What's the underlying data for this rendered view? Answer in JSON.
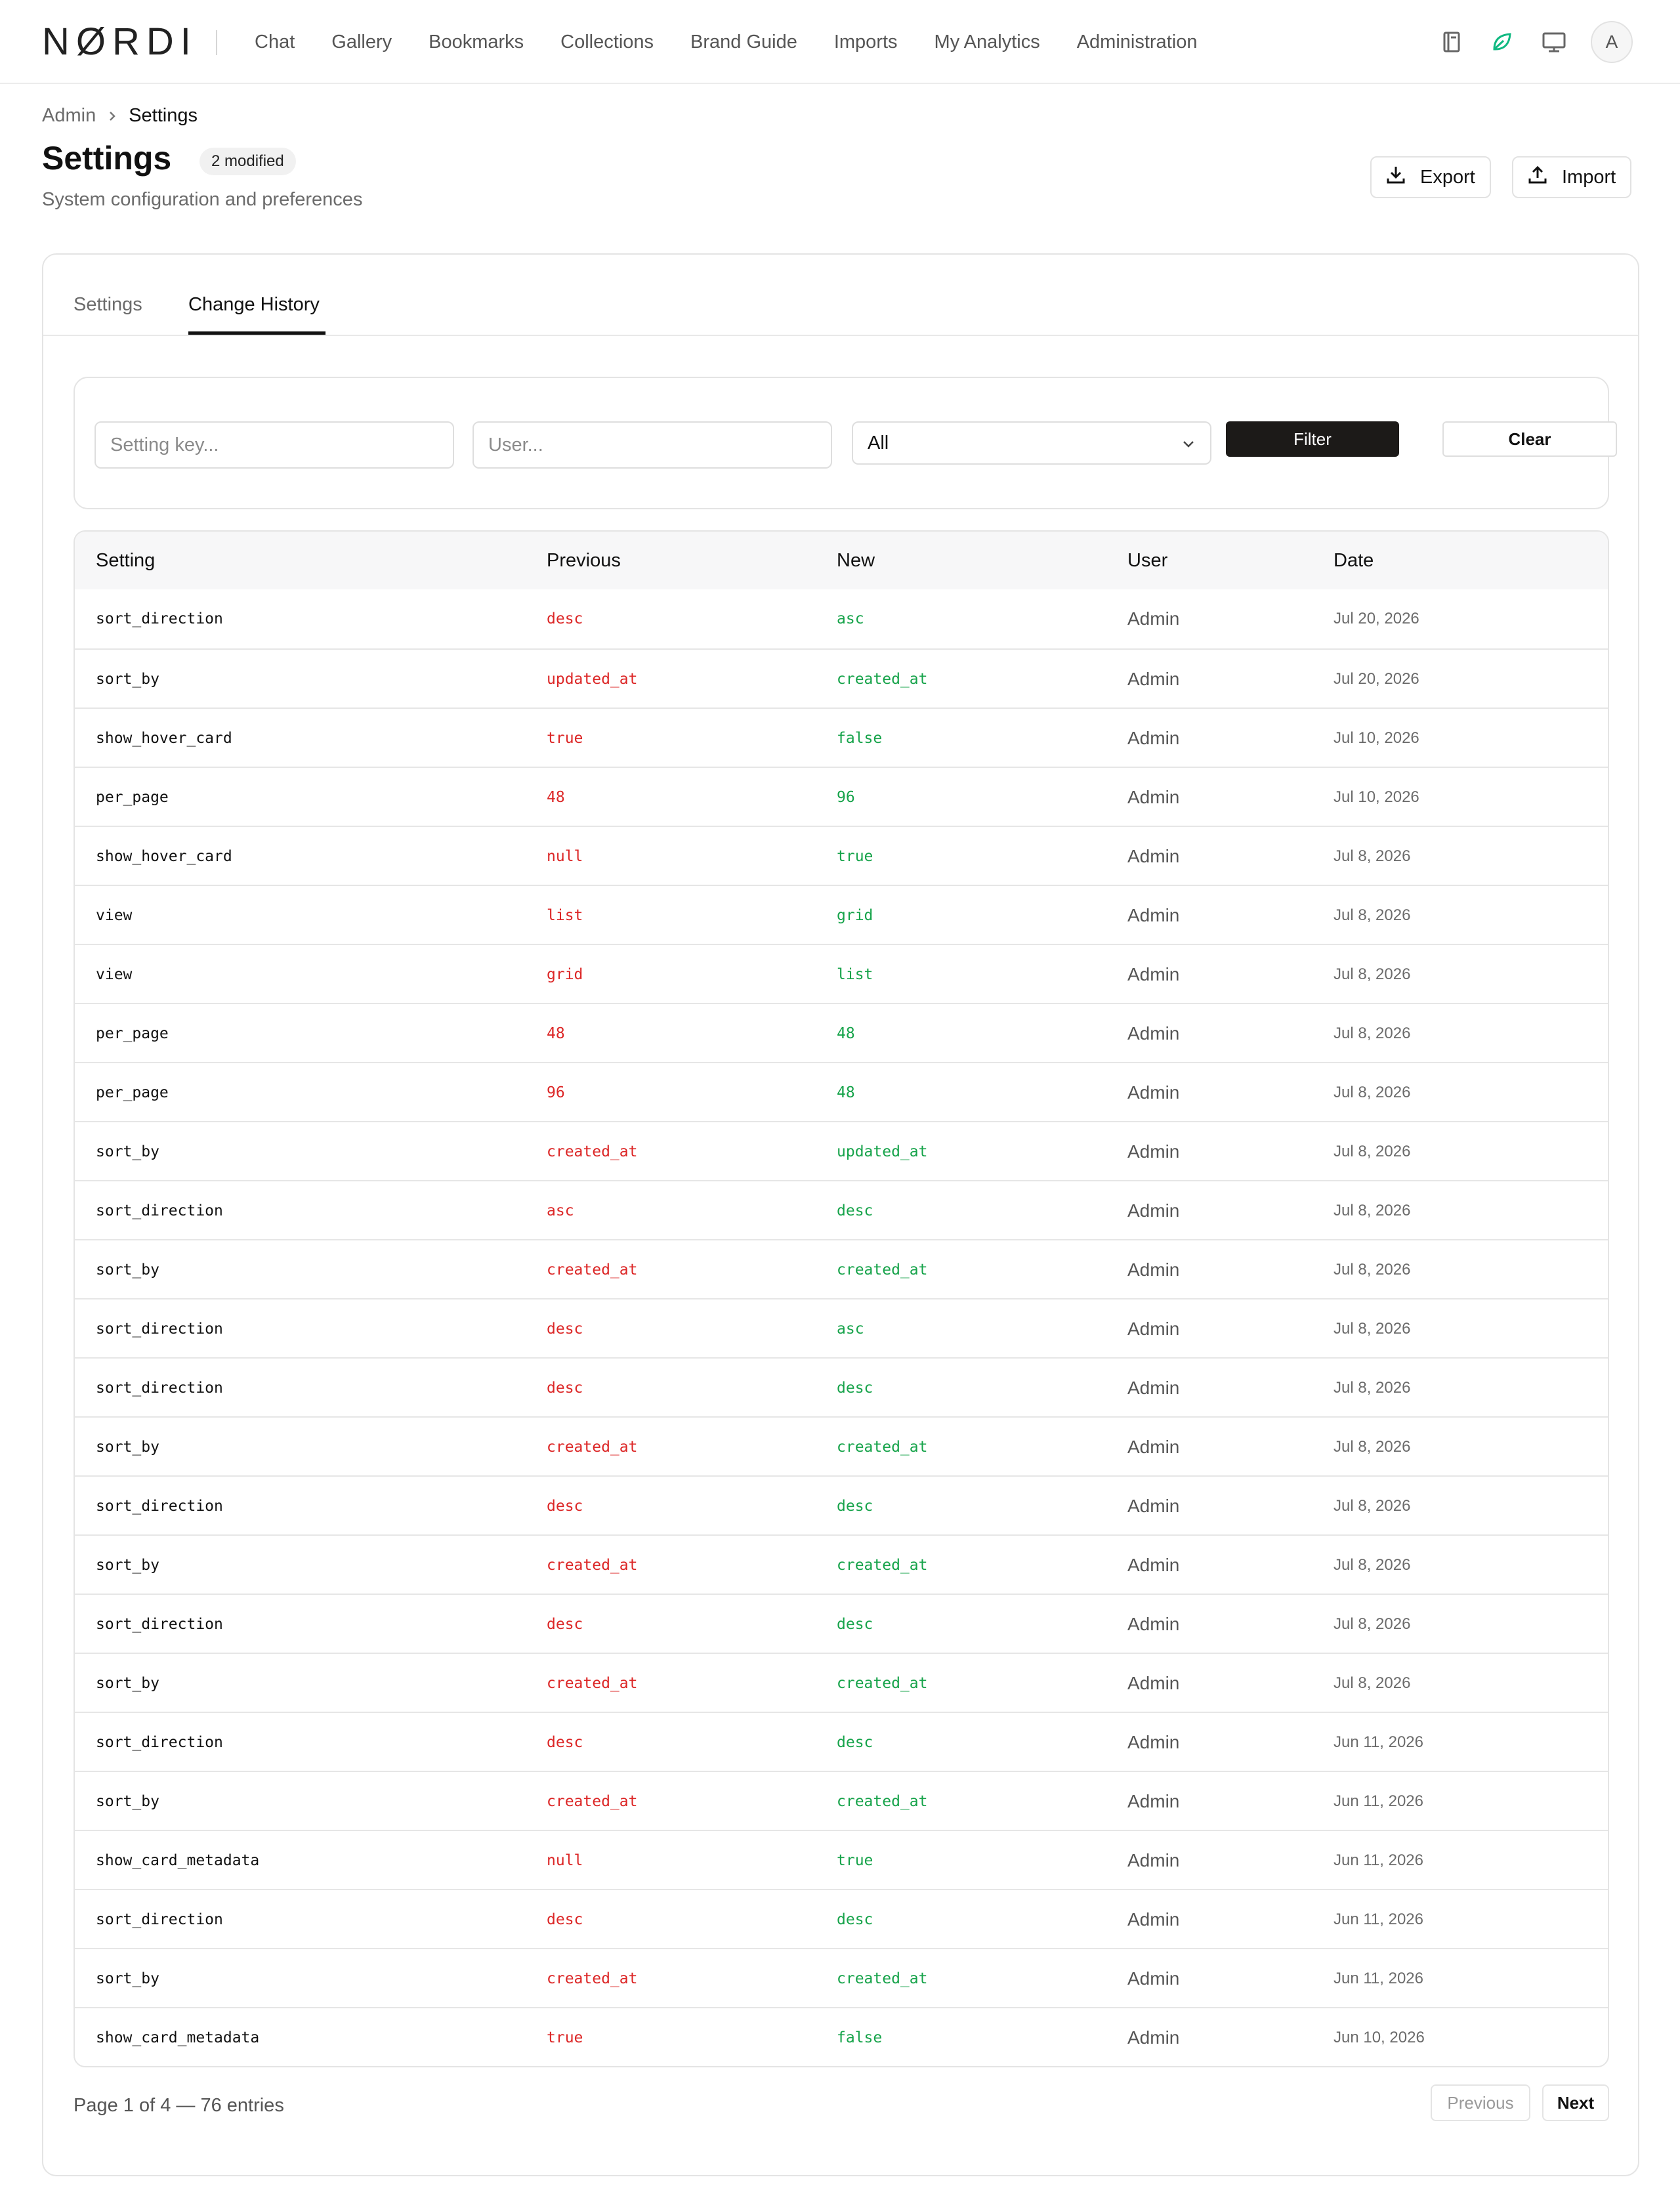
{
  "brand": {
    "logo": "NØRDI"
  },
  "nav": [
    "Chat",
    "Gallery",
    "Bookmarks",
    "Collections",
    "Brand Guide",
    "Imports",
    "My Analytics",
    "Administration"
  ],
  "header_icons": [
    "book-icon",
    "leaf-icon",
    "monitor-icon"
  ],
  "user": {
    "initial": "A"
  },
  "colors": {
    "accent_green": "#16a34a",
    "previous_red": "#dc2626",
    "leaf_icon": "#10b981",
    "primary_button": "#1c1a18"
  },
  "breadcrumb": {
    "root": "Admin",
    "current": "Settings"
  },
  "page": {
    "title": "Settings",
    "badge": "2 modified",
    "subtitle": "System configuration and preferences",
    "export_label": "Export",
    "import_label": "Import"
  },
  "tabs": {
    "settings": "Settings",
    "history": "Change History",
    "active": "Change History"
  },
  "filters": {
    "key_placeholder": "Setting key...",
    "user_placeholder": "User...",
    "select_value": "All",
    "filter_label": "Filter",
    "clear_label": "Clear"
  },
  "table": {
    "headers": {
      "setting": "Setting",
      "previous": "Previous",
      "new": "New",
      "user": "User",
      "date": "Date"
    },
    "rows": [
      {
        "setting": "sort_direction",
        "previous": "desc",
        "new": "asc",
        "user": "Admin",
        "date": "Jul 20, 2026"
      },
      {
        "setting": "sort_by",
        "previous": "updated_at",
        "new": "created_at",
        "user": "Admin",
        "date": "Jul 20, 2026"
      },
      {
        "setting": "show_hover_card",
        "previous": "true",
        "new": "false",
        "user": "Admin",
        "date": "Jul 10, 2026"
      },
      {
        "setting": "per_page",
        "previous": "48",
        "new": "96",
        "user": "Admin",
        "date": "Jul 10, 2026"
      },
      {
        "setting": "show_hover_card",
        "previous": "null",
        "new": "true",
        "user": "Admin",
        "date": "Jul 8, 2026"
      },
      {
        "setting": "view",
        "previous": "list",
        "new": "grid",
        "user": "Admin",
        "date": "Jul 8, 2026"
      },
      {
        "setting": "view",
        "previous": "grid",
        "new": "list",
        "user": "Admin",
        "date": "Jul 8, 2026"
      },
      {
        "setting": "per_page",
        "previous": "48",
        "new": "48",
        "user": "Admin",
        "date": "Jul 8, 2026"
      },
      {
        "setting": "per_page",
        "previous": "96",
        "new": "48",
        "user": "Admin",
        "date": "Jul 8, 2026"
      },
      {
        "setting": "sort_by",
        "previous": "created_at",
        "new": "updated_at",
        "user": "Admin",
        "date": "Jul 8, 2026"
      },
      {
        "setting": "sort_direction",
        "previous": "asc",
        "new": "desc",
        "user": "Admin",
        "date": "Jul 8, 2026"
      },
      {
        "setting": "sort_by",
        "previous": "created_at",
        "new": "created_at",
        "user": "Admin",
        "date": "Jul 8, 2026"
      },
      {
        "setting": "sort_direction",
        "previous": "desc",
        "new": "asc",
        "user": "Admin",
        "date": "Jul 8, 2026"
      },
      {
        "setting": "sort_direction",
        "previous": "desc",
        "new": "desc",
        "user": "Admin",
        "date": "Jul 8, 2026"
      },
      {
        "setting": "sort_by",
        "previous": "created_at",
        "new": "created_at",
        "user": "Admin",
        "date": "Jul 8, 2026"
      },
      {
        "setting": "sort_direction",
        "previous": "desc",
        "new": "desc",
        "user": "Admin",
        "date": "Jul 8, 2026"
      },
      {
        "setting": "sort_by",
        "previous": "created_at",
        "new": "created_at",
        "user": "Admin",
        "date": "Jul 8, 2026"
      },
      {
        "setting": "sort_direction",
        "previous": "desc",
        "new": "desc",
        "user": "Admin",
        "date": "Jul 8, 2026"
      },
      {
        "setting": "sort_by",
        "previous": "created_at",
        "new": "created_at",
        "user": "Admin",
        "date": "Jul 8, 2026"
      },
      {
        "setting": "sort_direction",
        "previous": "desc",
        "new": "desc",
        "user": "Admin",
        "date": "Jun 11, 2026"
      },
      {
        "setting": "sort_by",
        "previous": "created_at",
        "new": "created_at",
        "user": "Admin",
        "date": "Jun 11, 2026"
      },
      {
        "setting": "show_card_metadata",
        "previous": "null",
        "new": "true",
        "user": "Admin",
        "date": "Jun 11, 2026"
      },
      {
        "setting": "sort_direction",
        "previous": "desc",
        "new": "desc",
        "user": "Admin",
        "date": "Jun 11, 2026"
      },
      {
        "setting": "sort_by",
        "previous": "created_at",
        "new": "created_at",
        "user": "Admin",
        "date": "Jun 11, 2026"
      },
      {
        "setting": "show_card_metadata",
        "previous": "true",
        "new": "false",
        "user": "Admin",
        "date": "Jun 10, 2026"
      }
    ]
  },
  "pagination": {
    "summary": "Page 1 of 4 — 76 entries",
    "previous_label": "Previous",
    "next_label": "Next"
  }
}
